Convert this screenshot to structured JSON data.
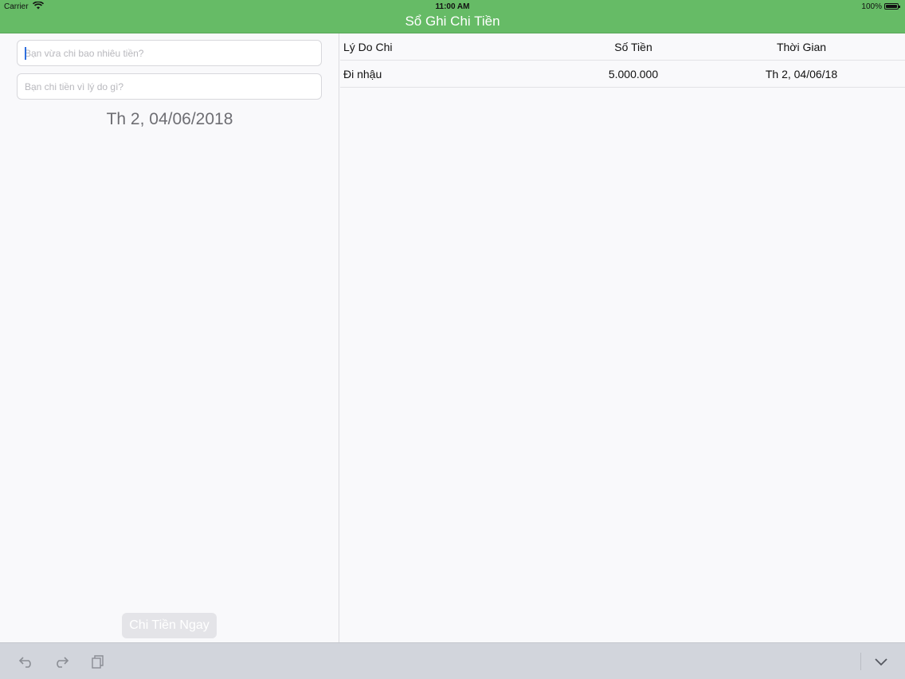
{
  "status_bar": {
    "carrier": "Carrier",
    "time": "11:00 AM",
    "battery_percent": "100%"
  },
  "nav": {
    "title": "Sổ Ghi Chi Tiền"
  },
  "form": {
    "amount_placeholder": "Bạn vừa chi bao nhiêu tiền?",
    "reason_placeholder": "Bạn chi tiền vì lý do gì?",
    "date": "Th 2, 04/06/2018",
    "submit_label": "Chi Tiền Ngay"
  },
  "table": {
    "columns": [
      "Lý Do Chi",
      "Số Tiền",
      "Thời Gian"
    ],
    "rows": [
      {
        "reason": "Đi nhậu",
        "amount": "5.000.000",
        "time": "Th 2, 04/06/18"
      }
    ]
  },
  "keyboard_toolbar": {
    "icons": [
      "undo-icon",
      "redo-icon",
      "paste-icon",
      "chevron-down-icon"
    ]
  },
  "colors": {
    "accent": "#66bb66",
    "text": "#111111"
  }
}
